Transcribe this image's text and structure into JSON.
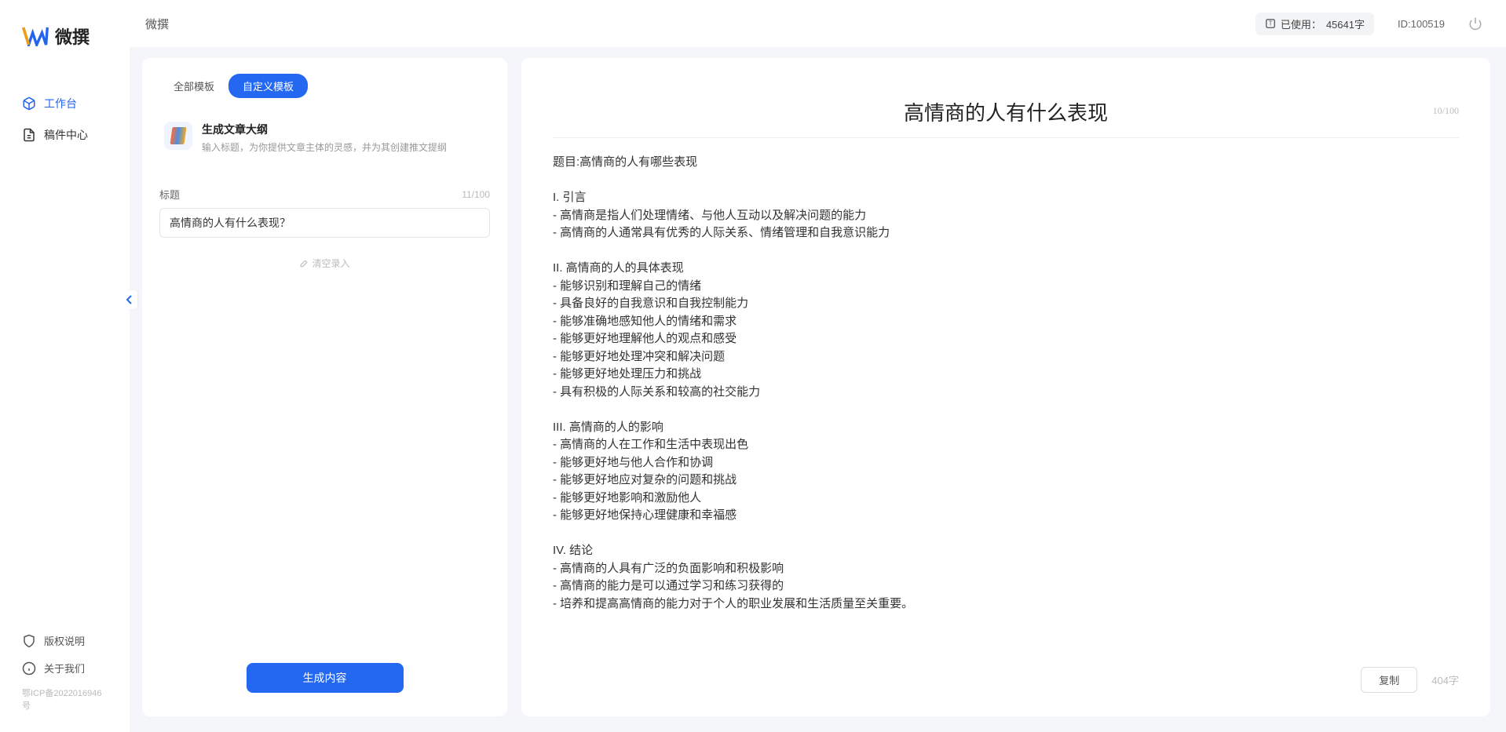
{
  "app": {
    "name": "微撰"
  },
  "sidebar": {
    "items": [
      {
        "label": "工作台",
        "active": true
      },
      {
        "label": "稿件中心",
        "active": false
      }
    ],
    "bottom": [
      {
        "label": "版权说明"
      },
      {
        "label": "关于我们"
      }
    ],
    "icp": "鄂ICP备2022016946号"
  },
  "topbar": {
    "title": "微撰",
    "usage_label": "已使用：",
    "usage_value": "45641字",
    "user_id_label": "ID:",
    "user_id": "100519"
  },
  "left": {
    "tabs": [
      {
        "label": "全部模板",
        "active": false
      },
      {
        "label": "自定义模板",
        "active": true
      }
    ],
    "template": {
      "title": "生成文章大纲",
      "desc": "输入标题，为你提供文章主体的灵感，并为其创建推文提纲"
    },
    "field_label": "标题",
    "char_count": "11/100",
    "input_value": "高情商的人有什么表现？",
    "clear_label": "清空录入",
    "generate_label": "生成内容"
  },
  "right": {
    "title": "高情商的人有什么表现",
    "top_count": "10/100",
    "body": "题目:高情商的人有哪些表现\n\nI. 引言\n- 高情商是指人们处理情绪、与他人互动以及解决问题的能力\n- 高情商的人通常具有优秀的人际关系、情绪管理和自我意识能力\n\nII. 高情商的人的具体表现\n- 能够识别和理解自己的情绪\n- 具备良好的自我意识和自我控制能力\n- 能够准确地感知他人的情绪和需求\n- 能够更好地理解他人的观点和感受\n- 能够更好地处理冲突和解决问题\n- 能够更好地处理压力和挑战\n- 具有积极的人际关系和较高的社交能力\n\nIII. 高情商的人的影响\n- 高情商的人在工作和生活中表现出色\n- 能够更好地与他人合作和协调\n- 能够更好地应对复杂的问题和挑战\n- 能够更好地影响和激励他人\n- 能够更好地保持心理健康和幸福感\n\nIV. 结论\n- 高情商的人具有广泛的负面影响和积极影响\n- 高情商的能力是可以通过学习和练习获得的\n- 培养和提高高情商的能力对于个人的职业发展和生活质量至关重要。",
    "copy_label": "复制",
    "word_count": "404字"
  }
}
